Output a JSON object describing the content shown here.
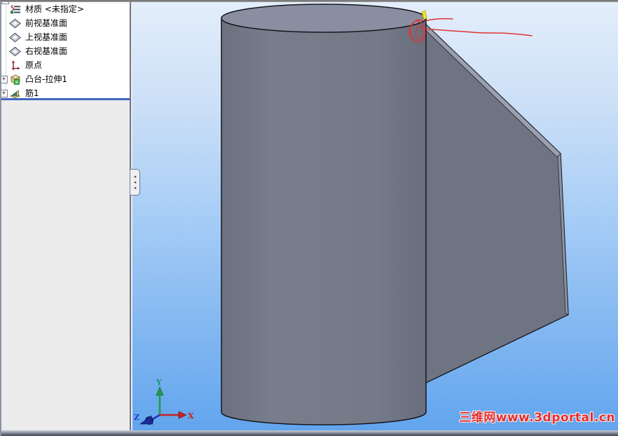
{
  "feature_tree": {
    "items": [
      {
        "label": "材质 <未指定>",
        "icon": "material-icon",
        "has_expander": false
      },
      {
        "label": "前视基准面",
        "icon": "plane-icon",
        "has_expander": false
      },
      {
        "label": "上视基准面",
        "icon": "plane-icon",
        "has_expander": false
      },
      {
        "label": "右视基准面",
        "icon": "plane-icon",
        "has_expander": false
      },
      {
        "label": "原点",
        "icon": "origin-icon",
        "has_expander": false
      },
      {
        "label": "凸台-拉伸1",
        "icon": "extrude-icon",
        "has_expander": true
      },
      {
        "label": "筋1",
        "icon": "rib-icon",
        "has_expander": true
      }
    ],
    "expander_glyph": "+"
  },
  "splitter": {
    "arrow_glyph": "◂"
  },
  "viewport": {
    "watermark": "三维网www.3dportal.cn",
    "triad": {
      "x_label": "X",
      "y_label": "Y",
      "z_label": "Z"
    }
  },
  "colors": {
    "background_top": "#e4eefb",
    "background_bottom": "#62a5ee",
    "cylinder_side": "#747987",
    "cylinder_top": "#898ea0",
    "rib_face": "#6f7482",
    "rib_edge_strip": "#9aa0af",
    "model_outline": "#15161e",
    "annotation_red": "#e03434",
    "highlight_yellow": "#f2e32a",
    "tree_divider_blue": "#4166bd",
    "watermark_red": "#e23030",
    "triad_x_red": "#c52222",
    "triad_y_green": "#0e9d5b",
    "triad_z_blue": "#1b2a9e"
  }
}
